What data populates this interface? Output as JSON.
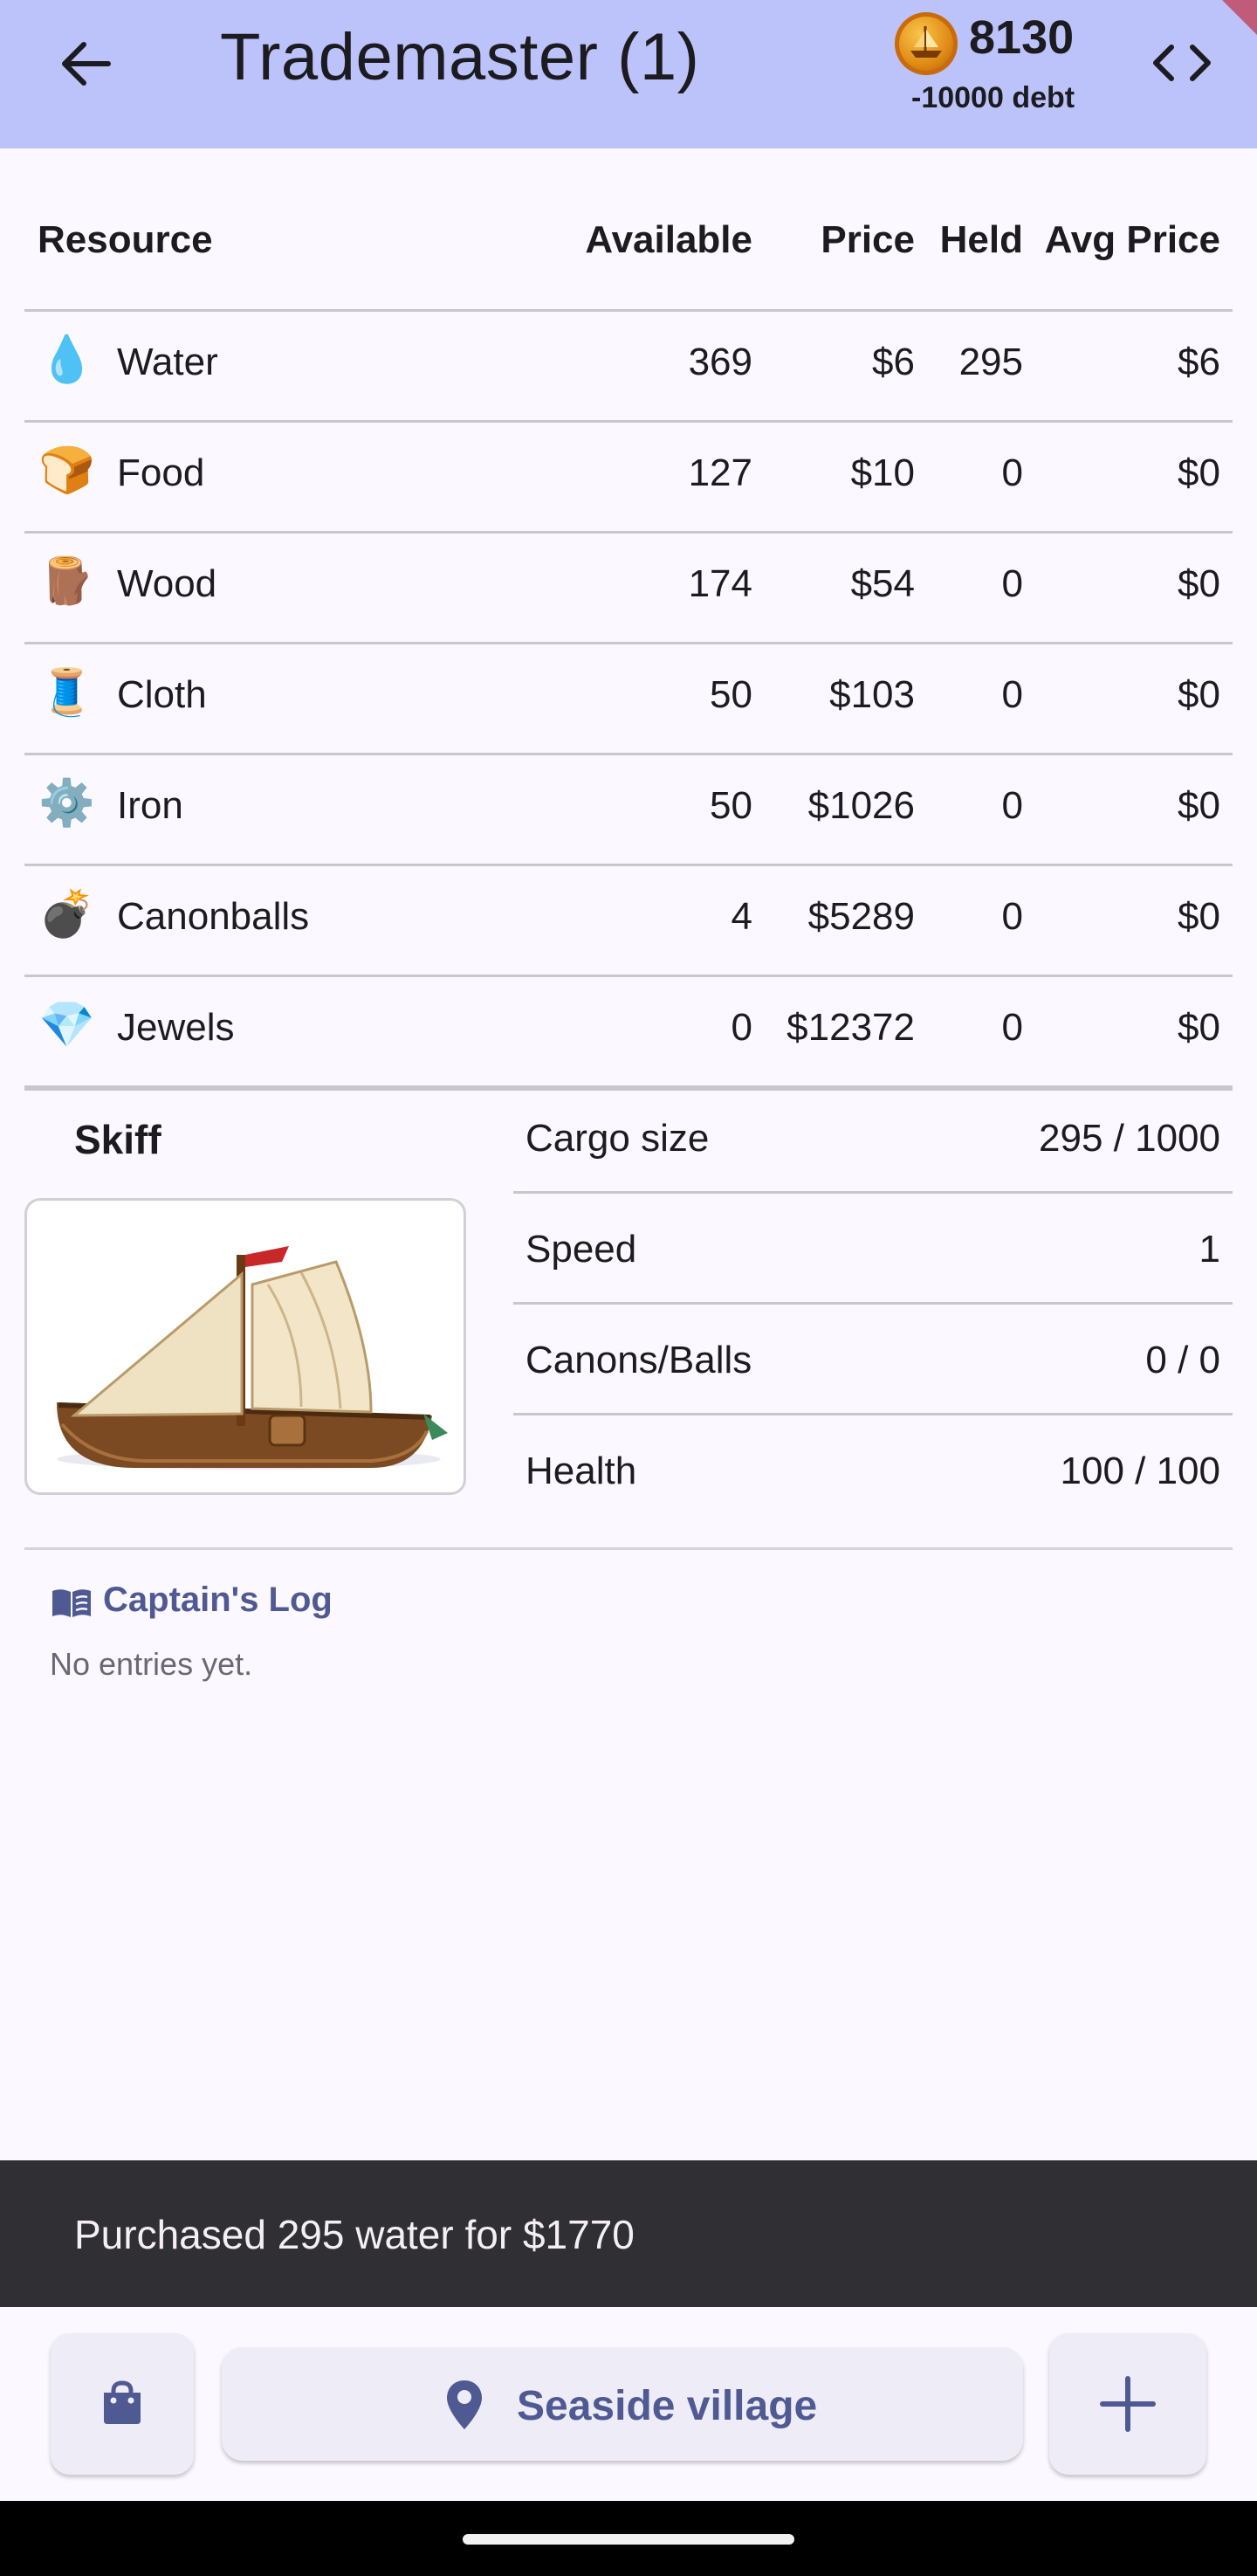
{
  "app_bar": {
    "title": "Trademaster (1)",
    "gold": "8130",
    "debt": "-10000 debt"
  },
  "table": {
    "headers": {
      "resource": "Resource",
      "available": "Available",
      "price": "Price",
      "held": "Held",
      "avg_price": "Avg Price"
    },
    "rows": [
      {
        "icon": "water-drop-icon",
        "glyph": "💧",
        "name": "Water",
        "available": "369",
        "price": "$6",
        "held": "295",
        "avg_price": "$6"
      },
      {
        "icon": "bread-icon",
        "glyph": "🍞",
        "name": "Food",
        "available": "127",
        "price": "$10",
        "held": "0",
        "avg_price": "$0"
      },
      {
        "icon": "wood-log-icon",
        "glyph": "🪵",
        "name": "Wood",
        "available": "174",
        "price": "$54",
        "held": "0",
        "avg_price": "$0"
      },
      {
        "icon": "thread-spool-icon",
        "glyph": "🧵",
        "name": "Cloth",
        "available": "50",
        "price": "$103",
        "held": "0",
        "avg_price": "$0"
      },
      {
        "icon": "gear-icon",
        "glyph": "⚙️",
        "name": "Iron",
        "available": "50",
        "price": "$1026",
        "held": "0",
        "avg_price": "$0"
      },
      {
        "icon": "bomb-icon",
        "glyph": "💣",
        "name": "Canonballs",
        "available": "4",
        "price": "$5289",
        "held": "0",
        "avg_price": "$0"
      },
      {
        "icon": "gem-icon",
        "glyph": "💎",
        "name": "Jewels",
        "available": "0",
        "price": "$12372",
        "held": "0",
        "avg_price": "$0"
      }
    ]
  },
  "ship": {
    "name": "Skiff",
    "stats": [
      {
        "label": "Cargo size",
        "value": "295 / 1000"
      },
      {
        "label": "Speed",
        "value": "1"
      },
      {
        "label": "Canons/Balls",
        "value": "0 / 0"
      },
      {
        "label": "Health",
        "value": "100 / 100"
      }
    ]
  },
  "captains_log": {
    "title": "Captain's Log",
    "empty_text": "No entries yet."
  },
  "snackbar": {
    "message": "Purchased 295 water for $1770"
  },
  "bottom_bar": {
    "location": "Seaside village"
  },
  "colors": {
    "app_bar": "#bcc3fa",
    "accent": "#4f5a93",
    "snackbar": "#303034"
  }
}
